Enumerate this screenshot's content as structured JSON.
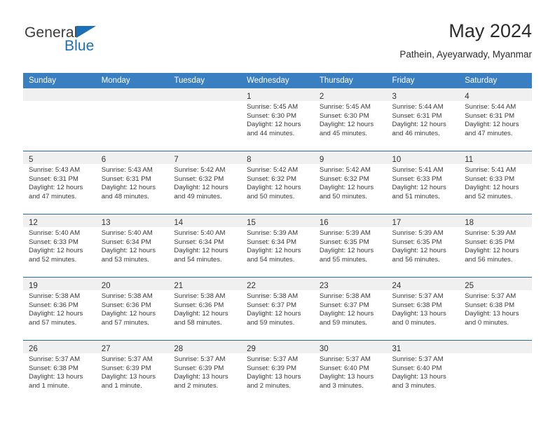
{
  "brand": {
    "name_part1": "General",
    "name_part2": "Blue",
    "triangle_color": "#1b70b8",
    "text_color": "#3c3c3c"
  },
  "header": {
    "month_title": "May 2024",
    "location": "Pathein, Ayeyarwady, Myanmar"
  },
  "theme": {
    "header_bg": "#3a7fc1",
    "row_border": "#2e6da4",
    "daynum_band": "#f0f0f0",
    "cell_bg": "#ffffff"
  },
  "weekday_headers": [
    "Sunday",
    "Monday",
    "Tuesday",
    "Wednesday",
    "Thursday",
    "Friday",
    "Saturday"
  ],
  "weeks": [
    [
      {
        "day": "",
        "empty": true,
        "sunrise": "",
        "sunset": "",
        "daylight1": "",
        "daylight2": ""
      },
      {
        "day": "",
        "empty": true,
        "sunrise": "",
        "sunset": "",
        "daylight1": "",
        "daylight2": ""
      },
      {
        "day": "",
        "empty": true,
        "sunrise": "",
        "sunset": "",
        "daylight1": "",
        "daylight2": ""
      },
      {
        "day": "1",
        "sunrise": "Sunrise: 5:45 AM",
        "sunset": "Sunset: 6:30 PM",
        "daylight1": "Daylight: 12 hours",
        "daylight2": "and 44 minutes."
      },
      {
        "day": "2",
        "sunrise": "Sunrise: 5:45 AM",
        "sunset": "Sunset: 6:30 PM",
        "daylight1": "Daylight: 12 hours",
        "daylight2": "and 45 minutes."
      },
      {
        "day": "3",
        "sunrise": "Sunrise: 5:44 AM",
        "sunset": "Sunset: 6:31 PM",
        "daylight1": "Daylight: 12 hours",
        "daylight2": "and 46 minutes."
      },
      {
        "day": "4",
        "sunrise": "Sunrise: 5:44 AM",
        "sunset": "Sunset: 6:31 PM",
        "daylight1": "Daylight: 12 hours",
        "daylight2": "and 47 minutes."
      }
    ],
    [
      {
        "day": "5",
        "sunrise": "Sunrise: 5:43 AM",
        "sunset": "Sunset: 6:31 PM",
        "daylight1": "Daylight: 12 hours",
        "daylight2": "and 47 minutes."
      },
      {
        "day": "6",
        "sunrise": "Sunrise: 5:43 AM",
        "sunset": "Sunset: 6:31 PM",
        "daylight1": "Daylight: 12 hours",
        "daylight2": "and 48 minutes."
      },
      {
        "day": "7",
        "sunrise": "Sunrise: 5:42 AM",
        "sunset": "Sunset: 6:32 PM",
        "daylight1": "Daylight: 12 hours",
        "daylight2": "and 49 minutes."
      },
      {
        "day": "8",
        "sunrise": "Sunrise: 5:42 AM",
        "sunset": "Sunset: 6:32 PM",
        "daylight1": "Daylight: 12 hours",
        "daylight2": "and 50 minutes."
      },
      {
        "day": "9",
        "sunrise": "Sunrise: 5:42 AM",
        "sunset": "Sunset: 6:32 PM",
        "daylight1": "Daylight: 12 hours",
        "daylight2": "and 50 minutes."
      },
      {
        "day": "10",
        "sunrise": "Sunrise: 5:41 AM",
        "sunset": "Sunset: 6:33 PM",
        "daylight1": "Daylight: 12 hours",
        "daylight2": "and 51 minutes."
      },
      {
        "day": "11",
        "sunrise": "Sunrise: 5:41 AM",
        "sunset": "Sunset: 6:33 PM",
        "daylight1": "Daylight: 12 hours",
        "daylight2": "and 52 minutes."
      }
    ],
    [
      {
        "day": "12",
        "sunrise": "Sunrise: 5:40 AM",
        "sunset": "Sunset: 6:33 PM",
        "daylight1": "Daylight: 12 hours",
        "daylight2": "and 52 minutes."
      },
      {
        "day": "13",
        "sunrise": "Sunrise: 5:40 AM",
        "sunset": "Sunset: 6:34 PM",
        "daylight1": "Daylight: 12 hours",
        "daylight2": "and 53 minutes."
      },
      {
        "day": "14",
        "sunrise": "Sunrise: 5:40 AM",
        "sunset": "Sunset: 6:34 PM",
        "daylight1": "Daylight: 12 hours",
        "daylight2": "and 54 minutes."
      },
      {
        "day": "15",
        "sunrise": "Sunrise: 5:39 AM",
        "sunset": "Sunset: 6:34 PM",
        "daylight1": "Daylight: 12 hours",
        "daylight2": "and 54 minutes."
      },
      {
        "day": "16",
        "sunrise": "Sunrise: 5:39 AM",
        "sunset": "Sunset: 6:35 PM",
        "daylight1": "Daylight: 12 hours",
        "daylight2": "and 55 minutes."
      },
      {
        "day": "17",
        "sunrise": "Sunrise: 5:39 AM",
        "sunset": "Sunset: 6:35 PM",
        "daylight1": "Daylight: 12 hours",
        "daylight2": "and 56 minutes."
      },
      {
        "day": "18",
        "sunrise": "Sunrise: 5:39 AM",
        "sunset": "Sunset: 6:35 PM",
        "daylight1": "Daylight: 12 hours",
        "daylight2": "and 56 minutes."
      }
    ],
    [
      {
        "day": "19",
        "sunrise": "Sunrise: 5:38 AM",
        "sunset": "Sunset: 6:36 PM",
        "daylight1": "Daylight: 12 hours",
        "daylight2": "and 57 minutes."
      },
      {
        "day": "20",
        "sunrise": "Sunrise: 5:38 AM",
        "sunset": "Sunset: 6:36 PM",
        "daylight1": "Daylight: 12 hours",
        "daylight2": "and 57 minutes."
      },
      {
        "day": "21",
        "sunrise": "Sunrise: 5:38 AM",
        "sunset": "Sunset: 6:36 PM",
        "daylight1": "Daylight: 12 hours",
        "daylight2": "and 58 minutes."
      },
      {
        "day": "22",
        "sunrise": "Sunrise: 5:38 AM",
        "sunset": "Sunset: 6:37 PM",
        "daylight1": "Daylight: 12 hours",
        "daylight2": "and 59 minutes."
      },
      {
        "day": "23",
        "sunrise": "Sunrise: 5:38 AM",
        "sunset": "Sunset: 6:37 PM",
        "daylight1": "Daylight: 12 hours",
        "daylight2": "and 59 minutes."
      },
      {
        "day": "24",
        "sunrise": "Sunrise: 5:37 AM",
        "sunset": "Sunset: 6:38 PM",
        "daylight1": "Daylight: 13 hours",
        "daylight2": "and 0 minutes."
      },
      {
        "day": "25",
        "sunrise": "Sunrise: 5:37 AM",
        "sunset": "Sunset: 6:38 PM",
        "daylight1": "Daylight: 13 hours",
        "daylight2": "and 0 minutes."
      }
    ],
    [
      {
        "day": "26",
        "sunrise": "Sunrise: 5:37 AM",
        "sunset": "Sunset: 6:38 PM",
        "daylight1": "Daylight: 13 hours",
        "daylight2": "and 1 minute."
      },
      {
        "day": "27",
        "sunrise": "Sunrise: 5:37 AM",
        "sunset": "Sunset: 6:39 PM",
        "daylight1": "Daylight: 13 hours",
        "daylight2": "and 1 minute."
      },
      {
        "day": "28",
        "sunrise": "Sunrise: 5:37 AM",
        "sunset": "Sunset: 6:39 PM",
        "daylight1": "Daylight: 13 hours",
        "daylight2": "and 2 minutes."
      },
      {
        "day": "29",
        "sunrise": "Sunrise: 5:37 AM",
        "sunset": "Sunset: 6:39 PM",
        "daylight1": "Daylight: 13 hours",
        "daylight2": "and 2 minutes."
      },
      {
        "day": "30",
        "sunrise": "Sunrise: 5:37 AM",
        "sunset": "Sunset: 6:40 PM",
        "daylight1": "Daylight: 13 hours",
        "daylight2": "and 3 minutes."
      },
      {
        "day": "31",
        "sunrise": "Sunrise: 5:37 AM",
        "sunset": "Sunset: 6:40 PM",
        "daylight1": "Daylight: 13 hours",
        "daylight2": "and 3 minutes."
      },
      {
        "day": "",
        "empty": true,
        "sunrise": "",
        "sunset": "",
        "daylight1": "",
        "daylight2": ""
      }
    ]
  ]
}
